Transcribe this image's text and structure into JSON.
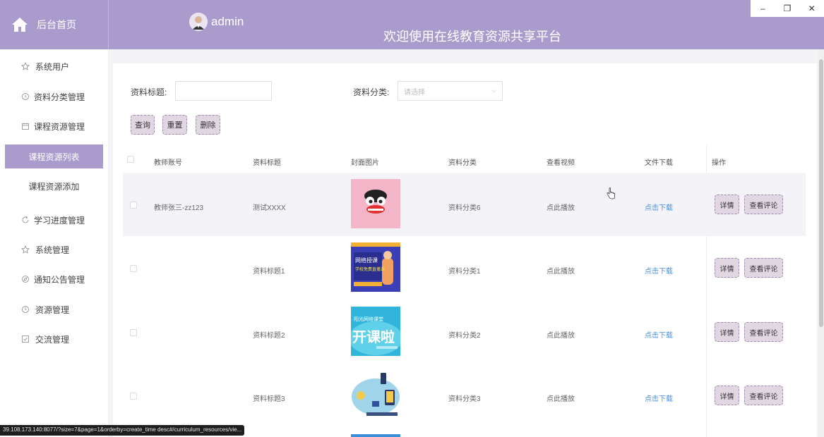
{
  "window": {
    "minimize": "–",
    "restore": "❐",
    "close": "✕"
  },
  "header": {
    "brand_label": "后台首页",
    "username": "admin",
    "site_title": "欢迎使用在线教育资源共享平台"
  },
  "sidebar": {
    "items": [
      {
        "label": "系统用户",
        "icon": "star-icon"
      },
      {
        "label": "资料分类管理",
        "icon": "clock-icon"
      },
      {
        "label": "课程资源管理",
        "icon": "calendar-icon"
      },
      {
        "label": "课程资源列表",
        "active": true
      },
      {
        "label": "课程资源添加"
      },
      {
        "label": "学习进度管理",
        "icon": "refresh-icon"
      },
      {
        "label": "系统管理",
        "icon": "star-icon"
      },
      {
        "label": "通知公告管理",
        "icon": "compass-icon"
      },
      {
        "label": "资源管理",
        "icon": "clock-icon"
      },
      {
        "label": "交流管理",
        "icon": "check-square-icon"
      }
    ]
  },
  "search": {
    "title_label": "资料标题:",
    "title_value": "",
    "category_label": "资料分类:",
    "category_placeholder": "请选择",
    "buttons": {
      "query": "查询",
      "reset": "重置",
      "delete": "删除"
    }
  },
  "table": {
    "headers": [
      "教师账号",
      "资料标题",
      "封面图片",
      "资料分类",
      "查看视频",
      "文件下载",
      "操作"
    ],
    "rows": [
      {
        "account": "教师张三-zz123",
        "title": "测试XXXX",
        "category": "资料分类6",
        "video": "点此播放",
        "download": "点击下载",
        "cover": "cartoon-face"
      },
      {
        "account": "",
        "title": "资料标题1",
        "category": "资料分类1",
        "video": "点此播放",
        "download": "点击下载",
        "cover": "course-banner"
      },
      {
        "account": "",
        "title": "资料标题2",
        "category": "资料分类2",
        "video": "点此播放",
        "download": "点击下载",
        "cover": "open-class"
      },
      {
        "account": "",
        "title": "资料标题3",
        "category": "资料分类3",
        "video": "点此播放",
        "download": "点击下载",
        "cover": "study-flow"
      }
    ],
    "row_actions": {
      "detail": "详情",
      "comments": "查看评论"
    }
  },
  "cover_text": {
    "course_banner_line1": "网络授课",
    "course_banner_line2": "学校免费直播课",
    "open_class_big": "开课啦",
    "open_class_small": "阳光网络课堂"
  },
  "status_bar": {
    "url": "39.108.173.140:8077/?size=7&page=1&orderby=create_time desc#/curriculum_resources/vie..."
  },
  "colors": {
    "primary": "#a99ccc",
    "button_bg": "#e0d7e3",
    "link": "#4a90e2"
  }
}
